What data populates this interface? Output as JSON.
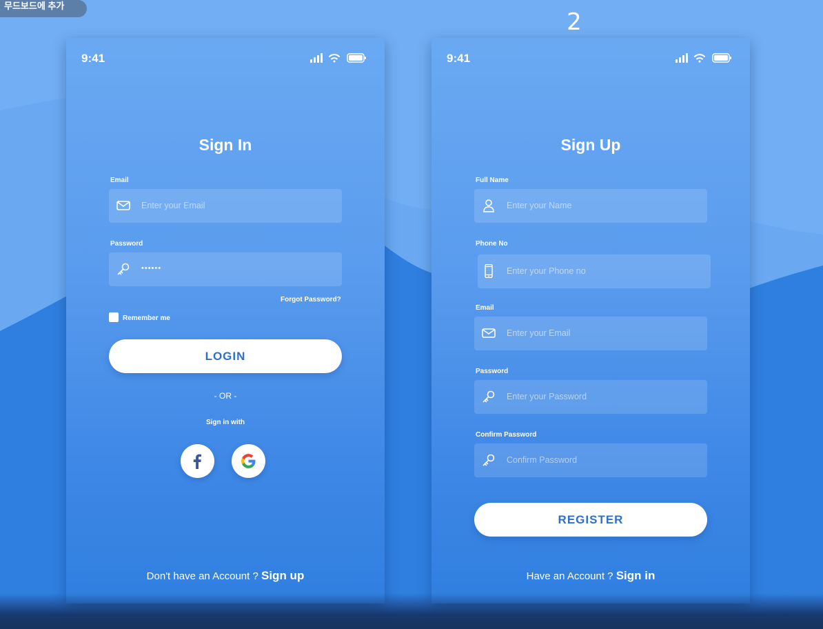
{
  "overlay": {
    "add_board_label": "무드보드에 추가",
    "page_number": "2"
  },
  "sign_in": {
    "status_time": "9:41",
    "title": "Sign In",
    "email_label": "Email",
    "email_placeholder": "Enter your Email",
    "password_label": "Password",
    "password_value": "••••••",
    "forgot_password": "Forgot Password?",
    "remember_me": "Remember me",
    "login_button": "LOGIN",
    "or_text": "- OR -",
    "sign_in_with": "Sign in with",
    "footer_prompt": "Don't have an Account ?",
    "footer_link": "Sign up"
  },
  "sign_up": {
    "status_time": "9:41",
    "title": "Sign Up",
    "fullname_label": "Full Name",
    "fullname_placeholder": "Enter your Name",
    "phone_label": "Phone No",
    "phone_placeholder": "Enter your Phone no",
    "email_label": "Email",
    "email_placeholder": "Enter your Email",
    "password_label": "Password",
    "password_placeholder": "Enter your Password",
    "confirm_label": "Confirm Password",
    "confirm_placeholder": "Confirm Password",
    "register_button": "REGISTER",
    "footer_prompt": "Have an Account ?",
    "footer_link": "Sign in"
  },
  "colors": {
    "accent_text": "#2f6fc9",
    "background_light": "#6aa9f2",
    "background_dark": "#2f7fe0"
  }
}
